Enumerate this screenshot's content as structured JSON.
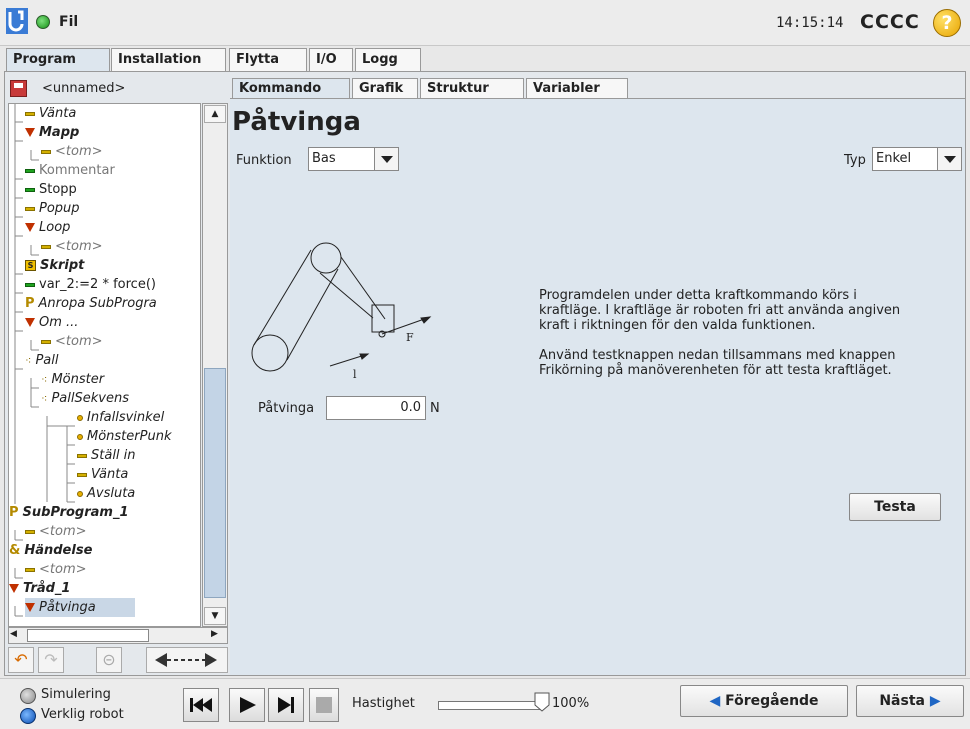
{
  "topbar": {
    "title": "Fil",
    "clock": "14:15:14",
    "robot_name": "CCCC",
    "help": "?"
  },
  "main_tabs": [
    "Program",
    "Installation",
    "Flytta",
    "I/O",
    "Logg"
  ],
  "file": {
    "name": "<unnamed>"
  },
  "sub_tabs": [
    "Kommando",
    "Grafik",
    "Struktur",
    "Variabler"
  ],
  "tree": [
    {
      "text": "Vänta",
      "style": "it"
    },
    {
      "text": "Mapp",
      "style": "bd it"
    },
    {
      "text": "<tom>",
      "style": "it grey"
    },
    {
      "text": "Kommentar",
      "style": "grey"
    },
    {
      "text": "Stopp",
      "style": ""
    },
    {
      "text": "Popup",
      "style": "it"
    },
    {
      "text": "Loop",
      "style": "it"
    },
    {
      "text": "<tom>",
      "style": "it grey"
    },
    {
      "text": "Skript",
      "style": "bd it"
    },
    {
      "text": "var_2:=2 * force()",
      "style": ""
    },
    {
      "text": "Anropa SubProgra",
      "style": "it"
    },
    {
      "text": "Om ...",
      "style": "it"
    },
    {
      "text": "<tom>",
      "style": "it grey"
    },
    {
      "text": "Pall",
      "style": "it"
    },
    {
      "text": "Mönster",
      "style": "it"
    },
    {
      "text": "PallSekvens",
      "style": "it"
    },
    {
      "text": "Infallsvinkel",
      "style": "it"
    },
    {
      "text": "MönsterPunk",
      "style": "it"
    },
    {
      "text": "Ställ in",
      "style": "it"
    },
    {
      "text": "Vänta",
      "style": "it"
    },
    {
      "text": "Avsluta",
      "style": "it"
    },
    {
      "text": "SubProgram_1",
      "style": "bd it"
    },
    {
      "text": "<tom>",
      "style": "it grey"
    },
    {
      "text": "Händelse",
      "style": "bd it"
    },
    {
      "text": "<tom>",
      "style": "it grey"
    },
    {
      "text": "Tråd_1",
      "style": "bd it"
    },
    {
      "text": "Påtvinga",
      "style": "it"
    }
  ],
  "command": {
    "title": "Påtvinga",
    "funktion_label": "Funktion",
    "funktion_value": "Bas",
    "typ_label": "Typ",
    "typ_value": "Enkel",
    "force_label": "Påtvinga",
    "force_value": "0.0",
    "force_unit": "N",
    "diagram_labels": {
      "f": "F",
      "l": "l"
    },
    "desc_1": "Programdelen under detta kraftkommando körs i kraftläge. I kraftläge är roboten fri att använda angiven kraft i riktningen för den valda funktionen.",
    "desc_2": "Använd testknappen nedan tillsammans med knappen Frikörning på manöverenheten för att testa kraftläget.",
    "test_button": "Testa"
  },
  "bottombar": {
    "sim_label": "Simulering",
    "real_label": "Verklig robot",
    "speed_label": "Hastighet",
    "speed_value": "100%",
    "speed_fraction": 1.0,
    "prev_button": "Föregående",
    "next_button": "Nästa"
  }
}
